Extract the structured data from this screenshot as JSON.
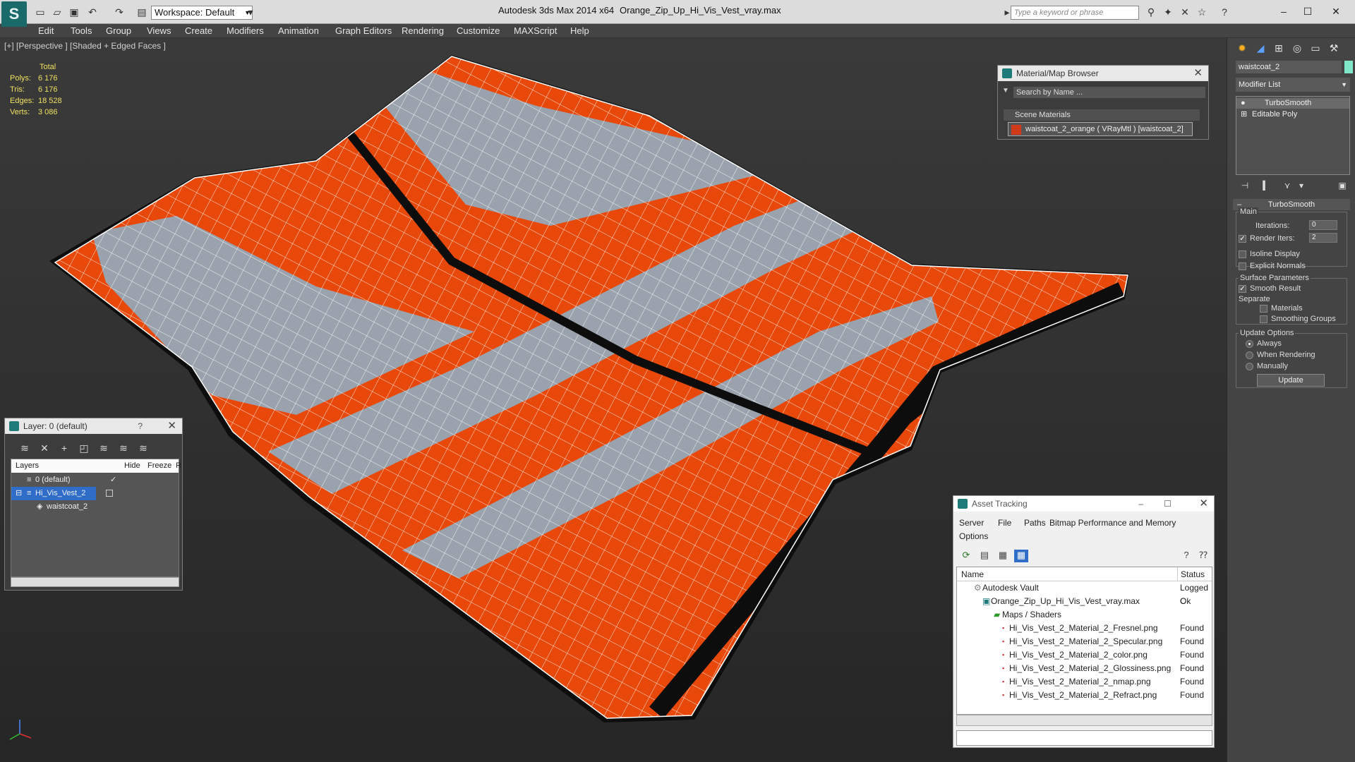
{
  "titlebar": {
    "app_title": "Autodesk 3ds Max  2014 x64",
    "file_title": "Orange_Zip_Up_Hi_Vis_Vest_vray.max",
    "workspace": "Workspace: Default",
    "search_placeholder": "Type a keyword or phrase"
  },
  "menu": [
    "Edit",
    "Tools",
    "Group",
    "Views",
    "Create",
    "Modifiers",
    "Animation",
    "Graph Editors",
    "Rendering",
    "Customize",
    "MAXScript",
    "Help"
  ],
  "viewport": {
    "label": "[+] [Perspective ] [Shaded + Edged Faces ]",
    "stats_header": "Total",
    "stats": [
      {
        "key": "Polys:",
        "value": "6 176"
      },
      {
        "key": "Tris:",
        "value": "6 176"
      },
      {
        "key": "Edges:",
        "value": "18 528"
      },
      {
        "key": "Verts:",
        "value": "3 086"
      }
    ],
    "colors": {
      "vest_orange": "#e8480a",
      "reflective": "#9aa3ad",
      "trim": "#0d0d0d"
    }
  },
  "material_browser": {
    "title": "Material/Map Browser",
    "search_placeholder": "Search by Name ...",
    "group": "Scene Materials",
    "item": "waistcoat_2_orange  ( VRayMtl )  [waistcoat_2]"
  },
  "layer_panel": {
    "title": "Layer: 0 (default)",
    "help": "?",
    "columns": {
      "layers": "Layers",
      "hide": "Hide",
      "freeze": "Freeze",
      "render": "R"
    },
    "rows": [
      {
        "name": "0 (default)"
      },
      {
        "name": "Hi_Vis_Vest_2"
      },
      {
        "name": "waistcoat_2"
      }
    ]
  },
  "asset_tracking": {
    "title": "Asset Tracking",
    "menu": [
      "Server",
      "File",
      "Paths",
      "Bitmap Performance and Memory",
      "Options"
    ],
    "columns": {
      "name": "Name",
      "status": "Status"
    },
    "rows": [
      {
        "name": "Autodesk Vault",
        "status": "Logged C"
      },
      {
        "name": "Orange_Zip_Up_Hi_Vis_Vest_vray.max",
        "status": "Ok"
      },
      {
        "name": "Maps / Shaders",
        "status": ""
      },
      {
        "name": "Hi_Vis_Vest_2_Material_2_Fresnel.png",
        "status": "Found"
      },
      {
        "name": "Hi_Vis_Vest_2_Material_2_Specular.png",
        "status": "Found"
      },
      {
        "name": "Hi_Vis_Vest_2_Material_2_color.png",
        "status": "Found"
      },
      {
        "name": "Hi_Vis_Vest_2_Material_2_Glossiness.png",
        "status": "Found"
      },
      {
        "name": "Hi_Vis_Vest_2_Material_2_nmap.png",
        "status": "Found"
      },
      {
        "name": "Hi_Vis_Vest_2_Material_2_Refract.png",
        "status": "Found"
      }
    ]
  },
  "command_panel": {
    "object_name": "waistcoat_2",
    "object_color": "#7fe6c8",
    "modifier_list": "Modifier List",
    "stack": [
      "TurboSmooth",
      "Editable Poly"
    ],
    "rollout": {
      "title": "TurboSmooth",
      "main": "Main",
      "iterations_label": "Iterations:",
      "iterations_value": "0",
      "render_iters_label": "Render Iters:",
      "render_iters_value": "2",
      "isoline": "Isoline Display",
      "explicit_normals": "Explicit Normals",
      "surface_params": "Surface Parameters",
      "smooth_result": "Smooth Result",
      "separate": "Separate",
      "materials": "Materials",
      "smoothing_groups": "Smoothing Groups",
      "update_options": "Update Options",
      "always": "Always",
      "when_rendering": "When Rendering",
      "manually": "Manually",
      "update": "Update"
    }
  }
}
